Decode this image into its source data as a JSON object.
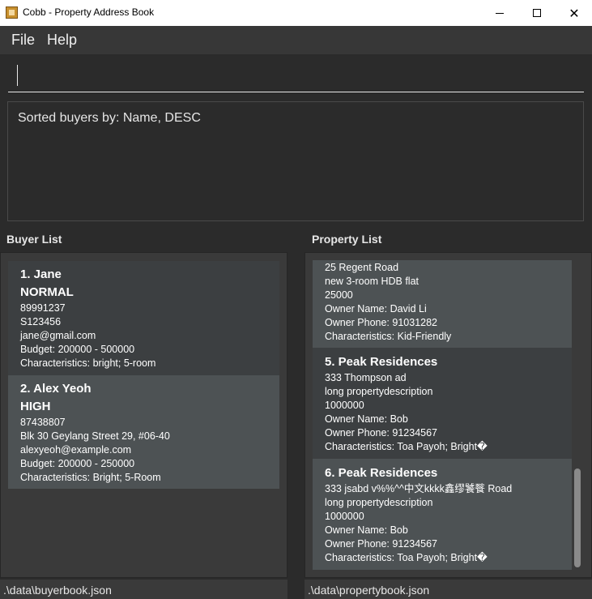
{
  "window": {
    "title": "Cobb - Property Address Book",
    "app_icon": "address-book-icon",
    "minimize_icon": "minimize-icon",
    "maximize_icon": "maximize-icon",
    "close_icon": "close-icon",
    "close_glyph": "✕"
  },
  "menu": {
    "file": "File",
    "help": "Help"
  },
  "command": {
    "value": "",
    "placeholder": ""
  },
  "result": {
    "text": "Sorted buyers by: Name, DESC"
  },
  "buyer_list": {
    "title": "Buyer List",
    "cards": [
      {
        "title": "1.  Jane",
        "priority": "NORMAL",
        "lines": [
          "89991237",
          "S123456",
          "jane@gmail.com",
          "Budget: 200000 - 500000",
          "Characteristics: bright; 5-room"
        ]
      },
      {
        "title": "2.  Alex Yeoh",
        "priority": "HIGH",
        "lines": [
          "87438807",
          "Blk 30 Geylang Street 29, #06-40",
          "alexyeoh@example.com",
          "Budget: 200000 - 250000",
          "Characteristics: Bright; 5-Room"
        ]
      }
    ]
  },
  "property_list": {
    "title": "Property List",
    "partial_card": {
      "lines": [
        "25 Regent Road",
        "new 3-room HDB flat",
        "25000",
        "Owner Name: David Li",
        "Owner Phone: 91031282",
        "Characteristics: Kid-Friendly"
      ]
    },
    "cards": [
      {
        "title": "5.  Peak Residences",
        "lines": [
          "333 Thompson ad",
          "long propertydescription",
          "1000000",
          "Owner Name: Bob",
          "Owner Phone: 91234567",
          "Characteristics: Toa Payoh; Bright�"
        ]
      },
      {
        "title": "6.  Peak Residences",
        "lines": [
          "333 jsabd   v%%^^中文kkkk鑫缪饕餮 Road",
          "long propertydescription",
          "1000000",
          "Owner Name: Bob",
          "Owner Phone: 91234567",
          "Characteristics: Toa Payoh; Bright�"
        ]
      }
    ]
  },
  "status": {
    "buyer_file": ".\\data\\buyerbook.json",
    "property_file": ".\\data\\propertybook.json"
  }
}
